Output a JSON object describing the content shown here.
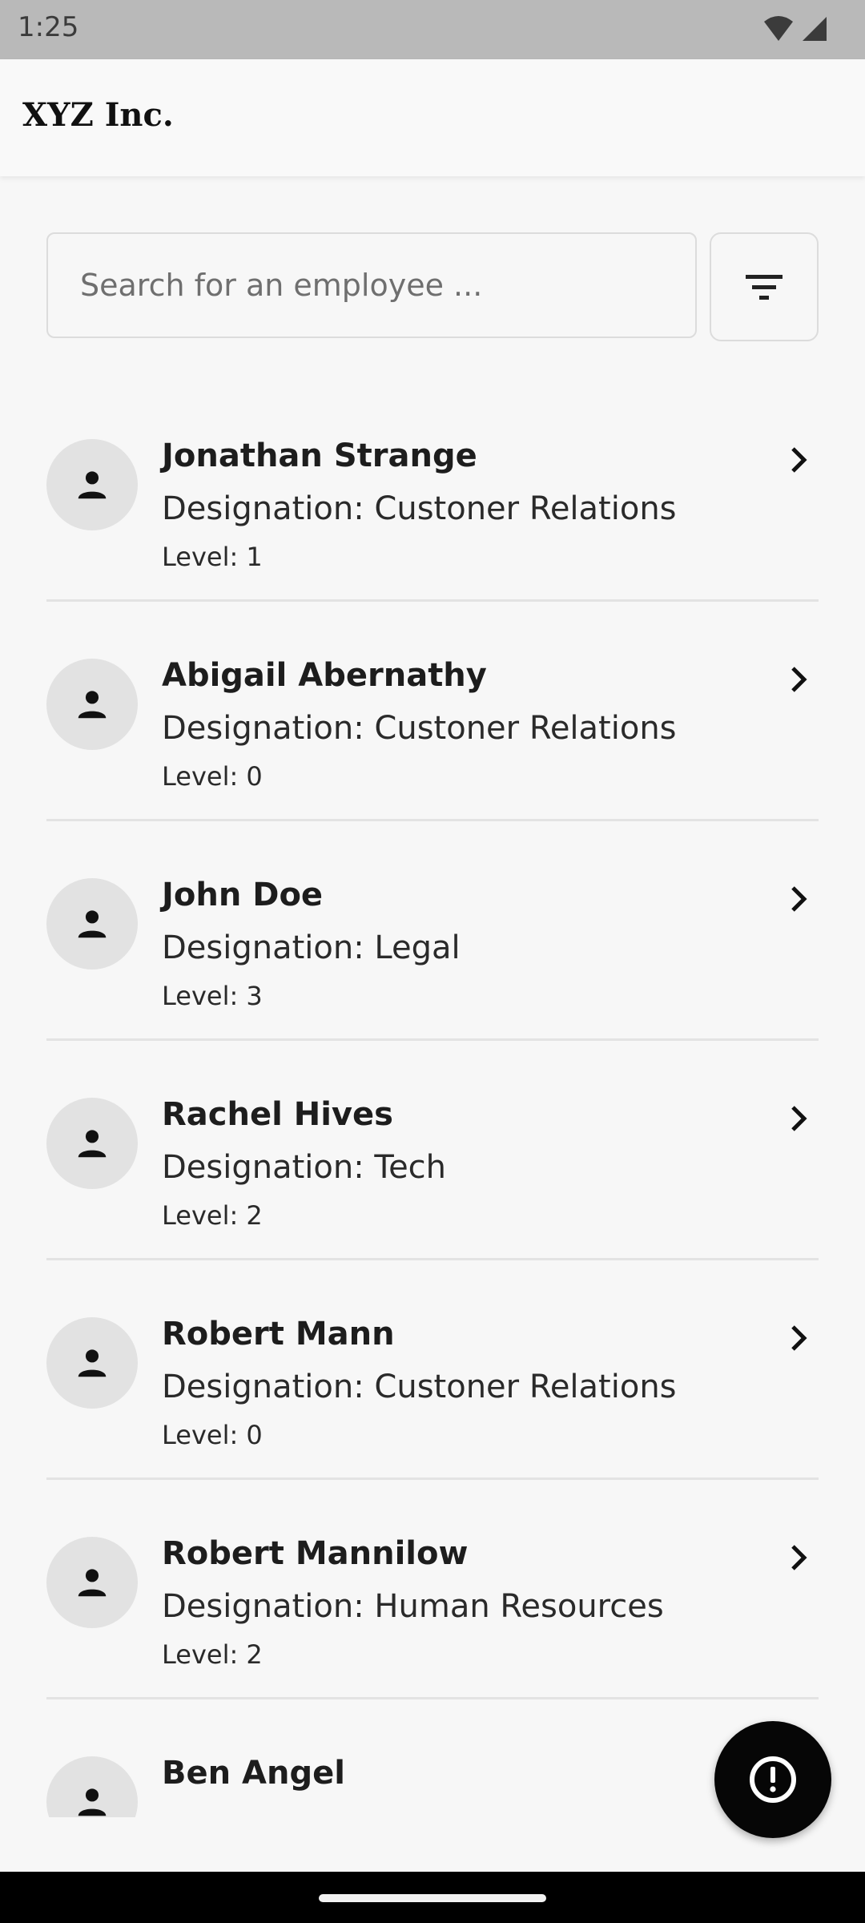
{
  "status_bar": {
    "time": "1:25",
    "icons": [
      "wifi-icon",
      "cellular-signal-icon"
    ]
  },
  "app_bar": {
    "title": "XYZ Inc."
  },
  "search": {
    "placeholder": "Search for an employee ...",
    "value": ""
  },
  "filter": {
    "icon": "filter-icon"
  },
  "employees": [
    {
      "name": "Jonathan Strange",
      "designation": "Designation: Custoner Relations",
      "level": "Level: 1"
    },
    {
      "name": "Abigail Abernathy",
      "designation": "Designation: Custoner Relations",
      "level": "Level: 0"
    },
    {
      "name": "John Doe",
      "designation": "Designation: Legal",
      "level": "Level: 3"
    },
    {
      "name": "Rachel Hives",
      "designation": "Designation: Tech",
      "level": "Level: 2"
    },
    {
      "name": "Robert Mann",
      "designation": "Designation: Custoner Relations",
      "level": "Level: 0"
    },
    {
      "name": "Robert Mannilow",
      "designation": "Designation: Human Resources",
      "level": "Level: 2"
    },
    {
      "name": "Ben Angel",
      "designation": "",
      "level": ""
    }
  ],
  "fab": {
    "icon": "alert-exclamation-icon"
  },
  "colors": {
    "status_bar": "#b9b9b9",
    "background": "#f7f7f7",
    "avatar_bg": "#e2e2e2",
    "fab_bg": "#060606",
    "nav_bar": "#000000"
  }
}
